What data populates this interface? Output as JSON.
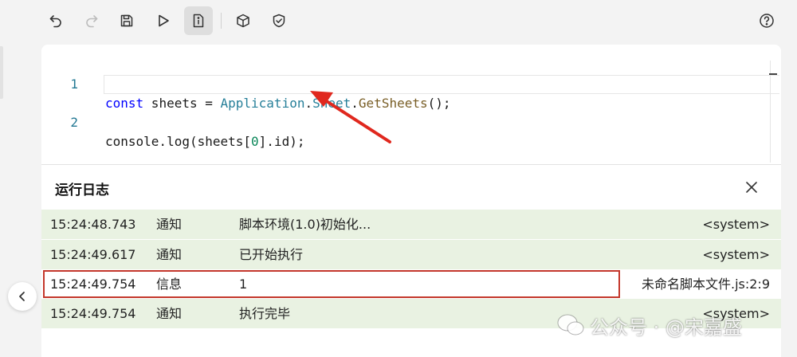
{
  "toolbar": {
    "icons": [
      "undo-icon",
      "redo-icon",
      "save-icon",
      "run-icon",
      "script-info-icon",
      "cube-icon",
      "shield-icon",
      "help-icon"
    ]
  },
  "editor": {
    "lines": [
      {
        "num": "1",
        "tokens": [
          {
            "t": "const",
            "c": "kw"
          },
          {
            "t": " sheets = ",
            "c": "pl"
          },
          {
            "t": "Application",
            "c": "ty"
          },
          {
            "t": ".",
            "c": "pl"
          },
          {
            "t": "Sheet",
            "c": "ty"
          },
          {
            "t": ".",
            "c": "pl"
          },
          {
            "t": "GetSheets",
            "c": "fn"
          },
          {
            "t": "();",
            "c": "pl"
          }
        ]
      },
      {
        "num": "2",
        "tokens": [
          {
            "t": "console.log(sheets[",
            "c": "pl"
          },
          {
            "t": "0",
            "c": "nm"
          },
          {
            "t": "].id);",
            "c": "pl"
          }
        ]
      }
    ],
    "annotation_color": "#e0281e"
  },
  "log": {
    "title": "运行日志",
    "rows": [
      {
        "time": "15:24:48.743",
        "level": "通知",
        "message": "脚本环境(1.0)初始化...",
        "source": "<system>",
        "kind": "notice"
      },
      {
        "time": "15:24:49.617",
        "level": "通知",
        "message": "已开始执行",
        "source": "<system>",
        "kind": "notice"
      },
      {
        "time": "15:24:49.754",
        "level": "信息",
        "message": "1",
        "source": "未命名脚本文件.js:2:9",
        "kind": "info"
      },
      {
        "time": "15:24:49.754",
        "level": "通知",
        "message": "执行完毕",
        "source": "<system>",
        "kind": "notice"
      }
    ],
    "highlight_color": "#c4372b"
  },
  "watermark": {
    "text": "公众号 · @宋嘉盛"
  }
}
